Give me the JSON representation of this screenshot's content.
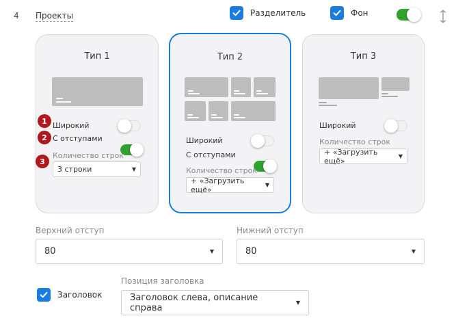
{
  "section": {
    "number": "4",
    "name": "Проекты"
  },
  "header": {
    "divider_label": "Разделитель",
    "background_label": "Фон"
  },
  "cards": [
    {
      "title": "Тип 1",
      "wide_label": "Широкий",
      "padding_label": "С отступами",
      "rows_label": "Количество строк",
      "rows_value": "3 строки"
    },
    {
      "title": "Тип 2",
      "wide_label": "Широкий",
      "padding_label": "С отступами",
      "rows_label": "Количество строк",
      "rows_value": "+ «Загрузить ещё»"
    },
    {
      "title": "Тип 3",
      "wide_label": "Широкий",
      "rows_label": "Количество строк",
      "rows_value": "+ «Загрузить ещё»"
    }
  ],
  "badges": [
    "1",
    "2",
    "3"
  ],
  "spacing": {
    "top_label": "Верхний отступ",
    "top_value": "80",
    "bottom_label": "Нижний отступ",
    "bottom_value": "80"
  },
  "heading": {
    "checkbox_label": "Заголовок",
    "position_label": "Позиция заголовка",
    "position_value": "Заголовок слева, описание справа"
  },
  "colors": {
    "accent": "#1a7ce0",
    "toggle_on": "#30a32e",
    "badge": "#b0181e"
  },
  "icons": {
    "check": "check-icon",
    "resize": "resize-vertical-icon",
    "caret": "caret-down-icon"
  }
}
